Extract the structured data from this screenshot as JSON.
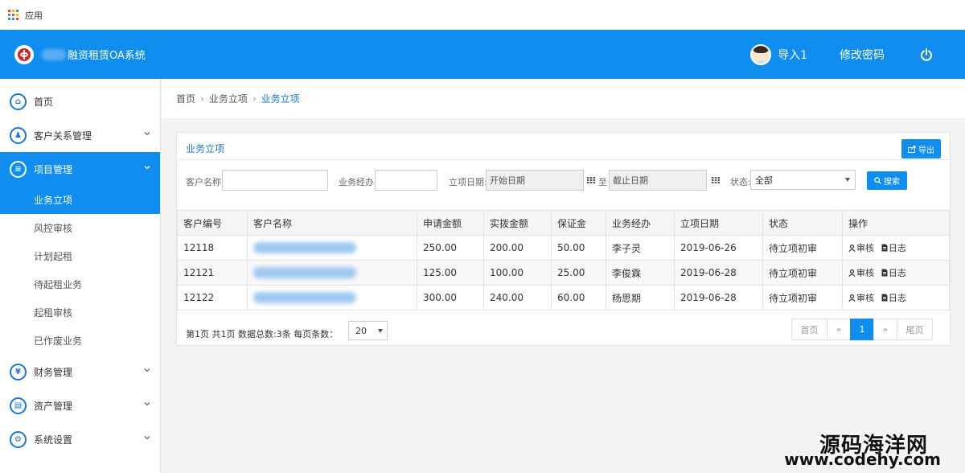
{
  "browser": {
    "apps_label": "应用"
  },
  "header": {
    "title_suffix": "融资租赁OA系统",
    "user_name": "导入1",
    "change_password": "修改密码"
  },
  "sidebar": {
    "items": [
      {
        "label": "首页",
        "icon": "home-icon",
        "glyph": "⌂"
      },
      {
        "label": "客户关系管理",
        "icon": "users-icon",
        "glyph": "♟"
      },
      {
        "label": "项目管理",
        "icon": "list-icon",
        "glyph": "≡"
      }
    ],
    "subitems": [
      "业务立项",
      "风控审核",
      "计划起租",
      "待起租业务",
      "起租审核",
      "已作废业务"
    ],
    "items_after": [
      {
        "label": "财务管理",
        "icon": "yen-icon",
        "glyph": "¥"
      },
      {
        "label": "资产管理",
        "icon": "document-icon",
        "glyph": "▤"
      },
      {
        "label": "系统设置",
        "icon": "gear-icon",
        "glyph": "⚙"
      }
    ]
  },
  "breadcrumb": [
    "首页",
    "业务立项",
    "业务立项"
  ],
  "panel": {
    "title": "业务立项",
    "export_label": "导出"
  },
  "filters": {
    "customer_name_label": "客户名称:",
    "customer_name_value": "",
    "manager_label": "业务经办:",
    "manager_value": "",
    "date_label": "立项日期:",
    "start_placeholder": "开始日期",
    "to_label": "至",
    "end_placeholder": "截止日期",
    "status_label": "状态:",
    "status_value": "全部",
    "search_label": "搜索"
  },
  "table": {
    "columns": [
      "客户编号",
      "客户名称",
      "申请金额",
      "实拨金额",
      "保证金",
      "业务经办",
      "立项日期",
      "状态",
      "操作"
    ],
    "rows": [
      {
        "id": "12118",
        "applied": "250.00",
        "disbursed": "200.00",
        "deposit": "50.00",
        "manager": "李子灵",
        "date": "2019-06-26",
        "status": "待立项初审"
      },
      {
        "id": "12121",
        "applied": "125.00",
        "disbursed": "100.00",
        "deposit": "25.00",
        "manager": "李俊霖",
        "date": "2019-06-28",
        "status": "待立项初审"
      },
      {
        "id": "12122",
        "applied": "300.00",
        "disbursed": "240.00",
        "deposit": "60.00",
        "manager": "杨思期",
        "date": "2019-06-28",
        "status": "待立项初审"
      }
    ],
    "actions": {
      "review": "审核",
      "log": "日志"
    }
  },
  "pager": {
    "info": "第1页 共1页 数据总数:3条 每页条数：",
    "page_size": "20",
    "first": "首页",
    "prev": "«",
    "current": "1",
    "next": "»",
    "last": "尾页"
  },
  "watermark": {
    "title": "源码海洋网",
    "url": "www.codehy.com"
  },
  "colors": {
    "primary": "#0f8ef0",
    "link": "#1976d2",
    "logo_red": "#d0262b"
  }
}
